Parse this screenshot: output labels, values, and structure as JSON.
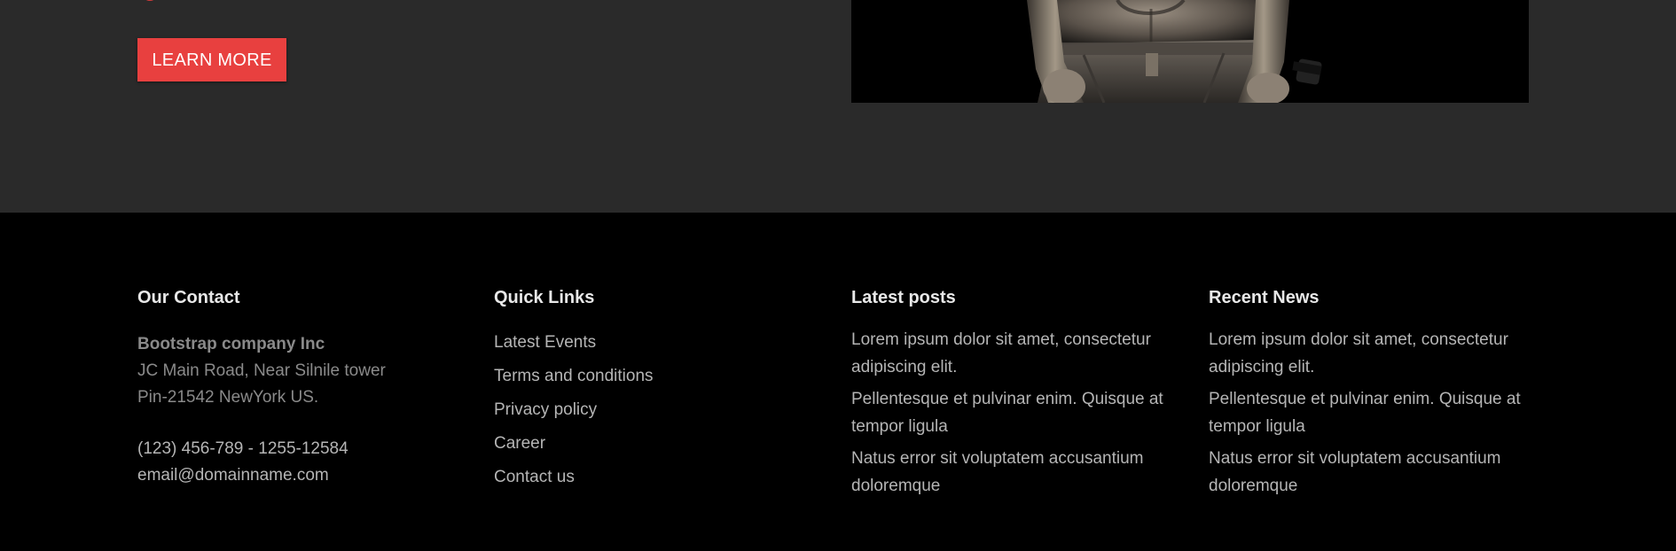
{
  "hero": {
    "button_label": "LEARN MORE",
    "accent_color": "#e8403f"
  },
  "footer": {
    "contact": {
      "heading": "Our Contact",
      "company": "Bootstrap company Inc",
      "address_line1": "JC Main Road, Near Silnile tower",
      "address_line2": "Pin-21542 NewYork US.",
      "phone": "(123) 456-789 - 1255-12584",
      "email": "email@domainname.com"
    },
    "quick_links": {
      "heading": "Quick Links",
      "items": [
        "Latest Events",
        "Terms and conditions",
        "Privacy policy",
        "Career",
        "Contact us"
      ]
    },
    "latest_posts": {
      "heading": "Latest posts",
      "items": [
        "Lorem ipsum dolor sit amet, consectetur adipiscing elit.",
        "Pellentesque et pulvinar enim. Quisque at tempor ligula",
        "Natus error sit voluptatem accusantium doloremque"
      ]
    },
    "recent_news": {
      "heading": "Recent News",
      "items": [
        "Lorem ipsum dolor sit amet, consectetur adipiscing elit.",
        "Pellentesque et pulvinar enim. Quisque at tempor ligula",
        "Natus error sit voluptatem accusantium doloremque"
      ]
    }
  }
}
